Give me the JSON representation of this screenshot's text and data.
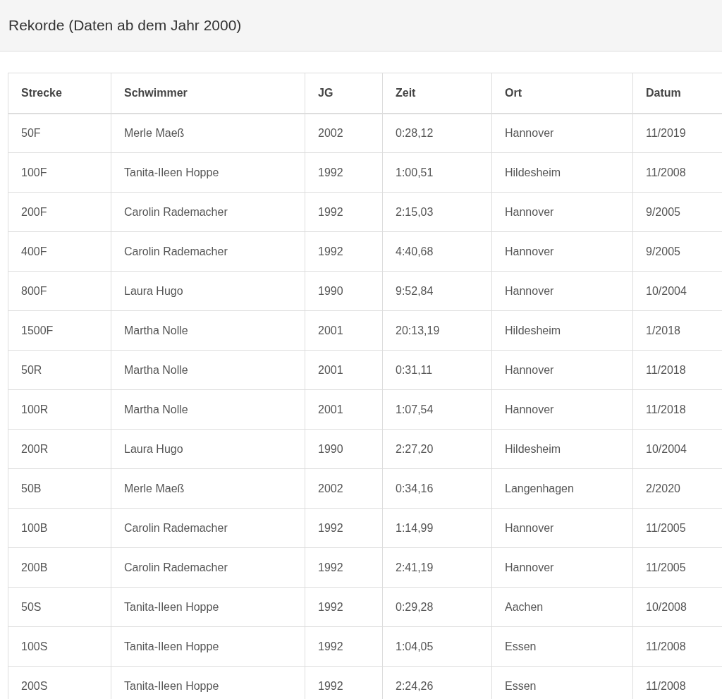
{
  "title": "Rekorde (Daten ab dem Jahr 2000)",
  "table": {
    "columns": [
      "Strecke",
      "Schwimmer",
      "JG",
      "Zeit",
      "Ort",
      "Datum"
    ],
    "rows": [
      [
        "50F",
        "Merle Maeß",
        "2002",
        "0:28,12",
        "Hannover",
        "11/2019"
      ],
      [
        "100F",
        "Tanita-Ileen Hoppe",
        "1992",
        "1:00,51",
        "Hildesheim",
        "11/2008"
      ],
      [
        "200F",
        "Carolin Rademacher",
        "1992",
        "2:15,03",
        "Hannover",
        "9/2005"
      ],
      [
        "400F",
        "Carolin Rademacher",
        "1992",
        "4:40,68",
        "Hannover",
        "9/2005"
      ],
      [
        "800F",
        "Laura Hugo",
        "1990",
        "9:52,84",
        "Hannover",
        "10/2004"
      ],
      [
        "1500F",
        "Martha Nolle",
        "2001",
        "20:13,19",
        "Hildesheim",
        "1/2018"
      ],
      [
        "50R",
        "Martha Nolle",
        "2001",
        "0:31,11",
        "Hannover",
        "11/2018"
      ],
      [
        "100R",
        "Martha Nolle",
        "2001",
        "1:07,54",
        "Hannover",
        "11/2018"
      ],
      [
        "200R",
        "Laura Hugo",
        "1990",
        "2:27,20",
        "Hildesheim",
        "10/2004"
      ],
      [
        "50B",
        "Merle Maeß",
        "2002",
        "0:34,16",
        "Langenhagen",
        "2/2020"
      ],
      [
        "100B",
        "Carolin Rademacher",
        "1992",
        "1:14,99",
        "Hannover",
        "11/2005"
      ],
      [
        "200B",
        "Carolin Rademacher",
        "1992",
        "2:41,19",
        "Hannover",
        "11/2005"
      ],
      [
        "50S",
        "Tanita-Ileen Hoppe",
        "1992",
        "0:29,28",
        "Aachen",
        "10/2008"
      ],
      [
        "100S",
        "Tanita-Ileen Hoppe",
        "1992",
        "1:04,05",
        "Essen",
        "11/2008"
      ],
      [
        "200S",
        "Tanita-Ileen Hoppe",
        "1992",
        "2:24,26",
        "Essen",
        "11/2008"
      ]
    ]
  }
}
